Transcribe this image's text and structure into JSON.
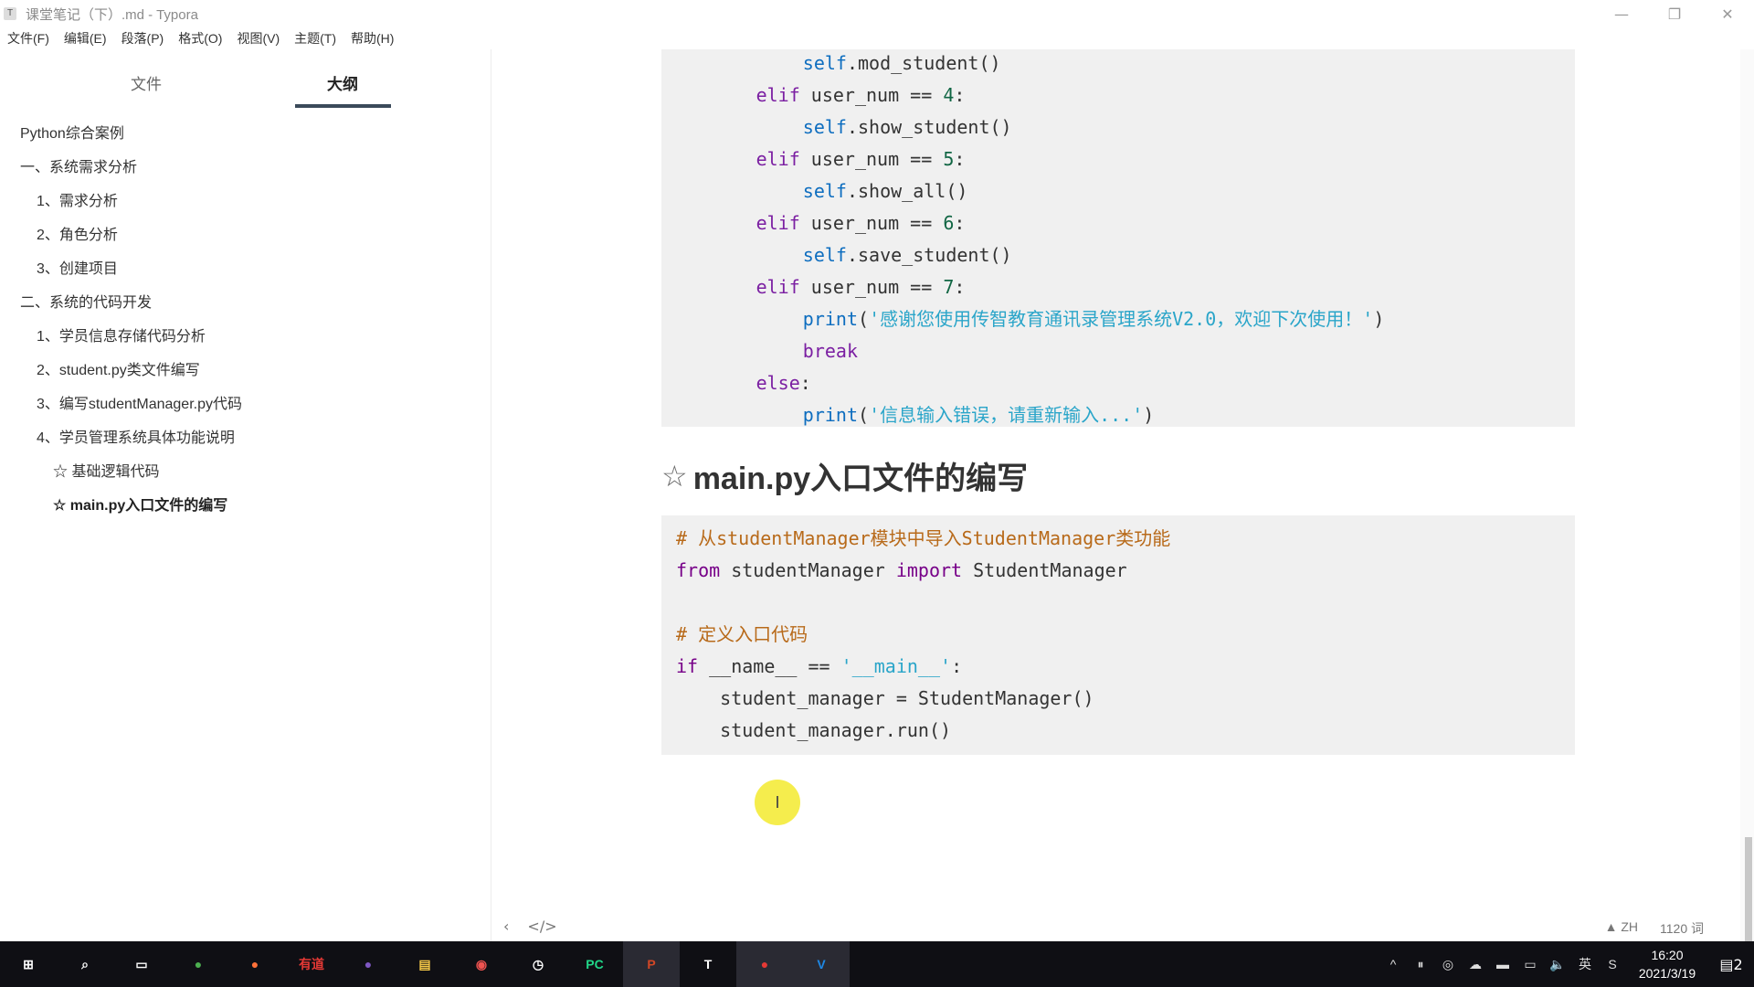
{
  "window": {
    "app_icon": "T",
    "title": "课堂笔记（下）.md - Typora",
    "controls": {
      "minimize": "—",
      "restore": "❐",
      "close": "✕"
    }
  },
  "menu": [
    "文件(F)",
    "编辑(E)",
    "段落(P)",
    "格式(O)",
    "视图(V)",
    "主题(T)",
    "帮助(H)"
  ],
  "sidebar": {
    "tabs": {
      "files": "文件",
      "outline": "大纲",
      "active": "outline"
    },
    "outline": [
      {
        "label": "Python综合案例",
        "level": 0
      },
      {
        "label": "一、系统需求分析",
        "level": 1
      },
      {
        "label": "1、需求分析",
        "level": 2
      },
      {
        "label": "2、角色分析",
        "level": 2
      },
      {
        "label": "3、创建项目",
        "level": 2
      },
      {
        "label": "二、系统的代码开发",
        "level": 1
      },
      {
        "label": "1、学员信息存储代码分析",
        "level": 2
      },
      {
        "label": "2、student.py类文件编写",
        "level": 2
      },
      {
        "label": "3、编写studentManager.py代码",
        "level": 2
      },
      {
        "label": "4、学员管理系统具体功能说明",
        "level": 2
      },
      {
        "label": "☆ 基础逻辑代码",
        "level": 3
      },
      {
        "label": "☆ main.py入口文件的编写",
        "level": 3,
        "active": true
      }
    ]
  },
  "editor": {
    "code_block_1": [
      [
        [
          "self",
          "self"
        ],
        [
          "plain",
          ".mod_student()"
        ]
      ],
      [
        [
          "kw",
          "elif"
        ],
        [
          "plain",
          " user_num == "
        ],
        [
          "num",
          "4"
        ],
        [
          "plain",
          ":"
        ]
      ],
      [
        [
          "self",
          "self"
        ],
        [
          "plain",
          ".show_student()"
        ]
      ],
      [
        [
          "kw",
          "elif"
        ],
        [
          "plain",
          " user_num == "
        ],
        [
          "num",
          "5"
        ],
        [
          "plain",
          ":"
        ]
      ],
      [
        [
          "self",
          "self"
        ],
        [
          "plain",
          ".show_all()"
        ]
      ],
      [
        [
          "kw",
          "elif"
        ],
        [
          "plain",
          " user_num == "
        ],
        [
          "num",
          "6"
        ],
        [
          "plain",
          ":"
        ]
      ],
      [
        [
          "self",
          "self"
        ],
        [
          "plain",
          ".save_student()"
        ]
      ],
      [
        [
          "kw",
          "elif"
        ],
        [
          "plain",
          " user_num == "
        ],
        [
          "num",
          "7"
        ],
        [
          "plain",
          ":"
        ]
      ],
      [
        [
          "self",
          "print"
        ],
        [
          "plain",
          "("
        ],
        [
          "str",
          "'感谢您使用传智教育通讯录管理系统V2.0，欢迎下次使用！'"
        ],
        [
          "plain",
          ")"
        ]
      ],
      [
        [
          "kw",
          "break"
        ]
      ],
      [
        [
          "kw",
          "else"
        ],
        [
          "plain",
          ":"
        ]
      ],
      [
        [
          "self",
          "print"
        ],
        [
          "plain",
          "("
        ],
        [
          "str",
          "'信息输入错误，请重新输入...'"
        ],
        [
          "plain",
          ")"
        ]
      ]
    ],
    "code_block_1_indent": [
      4,
      3,
      4,
      3,
      4,
      3,
      4,
      3,
      4,
      4,
      3,
      4
    ],
    "heading": {
      "star": "☆",
      "text": "main.py入口文件的编写"
    },
    "code_block_2": [
      [
        [
          "cmt",
          "# 从studentManager模块中导入StudentManager类功能"
        ]
      ],
      [
        [
          "kw2",
          "from"
        ],
        [
          "plain",
          " studentManager "
        ],
        [
          "kw2",
          "import"
        ],
        [
          "plain",
          " StudentManager"
        ]
      ],
      [],
      [
        [
          "cmt",
          "# 定义入口代码"
        ]
      ],
      [
        [
          "kw2",
          "if"
        ],
        [
          "plain",
          " __name__ == "
        ],
        [
          "str",
          "'__main__'"
        ],
        [
          "plain",
          ":"
        ]
      ],
      [
        [
          "plain",
          "    student_manager = StudentManager()"
        ]
      ],
      [
        [
          "plain",
          "    student_manager.run()"
        ]
      ]
    ],
    "cursor": "I"
  },
  "status": {
    "back": "‹",
    "source_toggle": "</>",
    "lang": "ZH",
    "word_count": "1120 词"
  },
  "taskbar": {
    "apps": [
      {
        "name": "start-menu",
        "glyph": "⊞",
        "color": "#ffffff"
      },
      {
        "name": "search",
        "glyph": "⌕",
        "color": "#ffffff"
      },
      {
        "name": "task-view",
        "glyph": "▭",
        "color": "#ffffff"
      },
      {
        "name": "chrome",
        "glyph": "●",
        "color": "#4caf50"
      },
      {
        "name": "firefox",
        "glyph": "●",
        "color": "#ff7139"
      },
      {
        "name": "youdao",
        "glyph": "有道",
        "color": "#e53935"
      },
      {
        "name": "browser",
        "glyph": "●",
        "color": "#7e57c2"
      },
      {
        "name": "file-explorer",
        "glyph": "▤",
        "color": "#f7c948"
      },
      {
        "name": "recorder",
        "glyph": "◉",
        "color": "#ef5350"
      },
      {
        "name": "clock-app",
        "glyph": "◷",
        "color": "#ffffff"
      },
      {
        "name": "pycharm",
        "glyph": "PC",
        "color": "#21d789"
      },
      {
        "name": "powerpoint",
        "glyph": "P",
        "color": "#d24726"
      },
      {
        "name": "typora",
        "glyph": "T",
        "color": "#ffffff"
      },
      {
        "name": "screen-recorder",
        "glyph": "●",
        "color": "#e53935"
      },
      {
        "name": "vscode",
        "glyph": "V",
        "color": "#1e88e5"
      }
    ],
    "active_apps": [
      "powerpoint",
      "screen-recorder",
      "vscode"
    ],
    "tray": [
      "^",
      "⏸",
      "◎",
      "☁",
      "▬",
      "▭",
      "🔈",
      "英",
      "S"
    ],
    "time": "16:20",
    "date": "2021/3/19",
    "notifications": "2"
  }
}
